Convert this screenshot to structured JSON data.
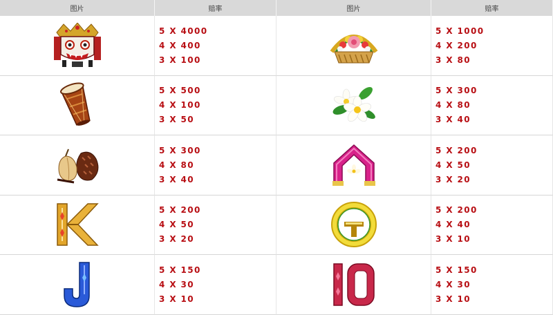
{
  "headers": [
    "图片",
    "赔率",
    "图片",
    "赔率"
  ],
  "rows": [
    {
      "left": {
        "symbol": "barong-mask-icon",
        "odds": [
          "5 X 4000",
          "4 X 400",
          "3 X 100"
        ]
      },
      "right": {
        "symbol": "flower-offering-icon",
        "odds": [
          "5 X 1000",
          "4 X 200",
          "3 X 80"
        ]
      }
    },
    {
      "left": {
        "symbol": "kendang-drum-icon",
        "odds": [
          "5 X 500",
          "4 X 100",
          "3 X 50"
        ]
      },
      "right": {
        "symbol": "frangipani-flower-icon",
        "odds": [
          "5 X 300",
          "4 X 80",
          "3 X 40"
        ]
      }
    },
    {
      "left": {
        "symbol": "salak-fruit-icon",
        "odds": [
          "5 X 300",
          "4 X 80",
          "3 X 40"
        ]
      },
      "right": {
        "symbol": "letter-a-icon",
        "odds": [
          "5 X 200",
          "4 X 50",
          "3 X 20"
        ]
      }
    },
    {
      "left": {
        "symbol": "letter-k-icon",
        "odds": [
          "5 X 200",
          "4 X 50",
          "3 X 20"
        ]
      },
      "right": {
        "symbol": "letter-q-icon",
        "odds": [
          "5 X 200",
          "4 X 40",
          "3 X 10"
        ]
      }
    },
    {
      "left": {
        "symbol": "letter-j-icon",
        "odds": [
          "5 X 150",
          "4 X 30",
          "3 X 10"
        ]
      },
      "right": {
        "symbol": "number-10-icon",
        "odds": [
          "5 X 150",
          "4 X 30",
          "3 X 10"
        ]
      }
    }
  ]
}
